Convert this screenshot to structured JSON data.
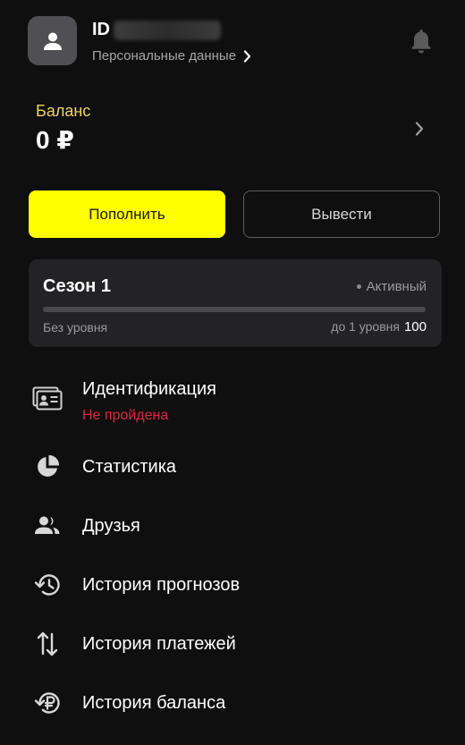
{
  "profile": {
    "id_label": "ID",
    "personal_data_link": "Персональные данные"
  },
  "balance": {
    "label": "Баланс",
    "value": "0 ₽"
  },
  "actions": {
    "deposit_label": "Пополнить",
    "withdraw_label": "Вывести"
  },
  "season": {
    "title": "Сезон 1",
    "status": "Активный",
    "progress_fraction": 0,
    "level_current": "Без уровня",
    "level_next_text": "до 1 уровня",
    "level_next_points": "100"
  },
  "menu": [
    {
      "label": "Идентификация",
      "sublabel": "Не пройдена",
      "icon": "id-card-icon"
    },
    {
      "label": "Статистика",
      "icon": "pie-chart-icon"
    },
    {
      "label": "Друзья",
      "icon": "friends-icon"
    },
    {
      "label": "История прогнозов",
      "icon": "history-clock-icon"
    },
    {
      "label": "История платежей",
      "icon": "transfer-arrows-icon"
    },
    {
      "label": "История баланса",
      "icon": "ruble-history-icon"
    }
  ],
  "colors": {
    "accent": "#ffff00",
    "balance_label": "#f0d36a",
    "error": "#e0283c",
    "background": "#0f0f0f",
    "card": "#232325"
  }
}
